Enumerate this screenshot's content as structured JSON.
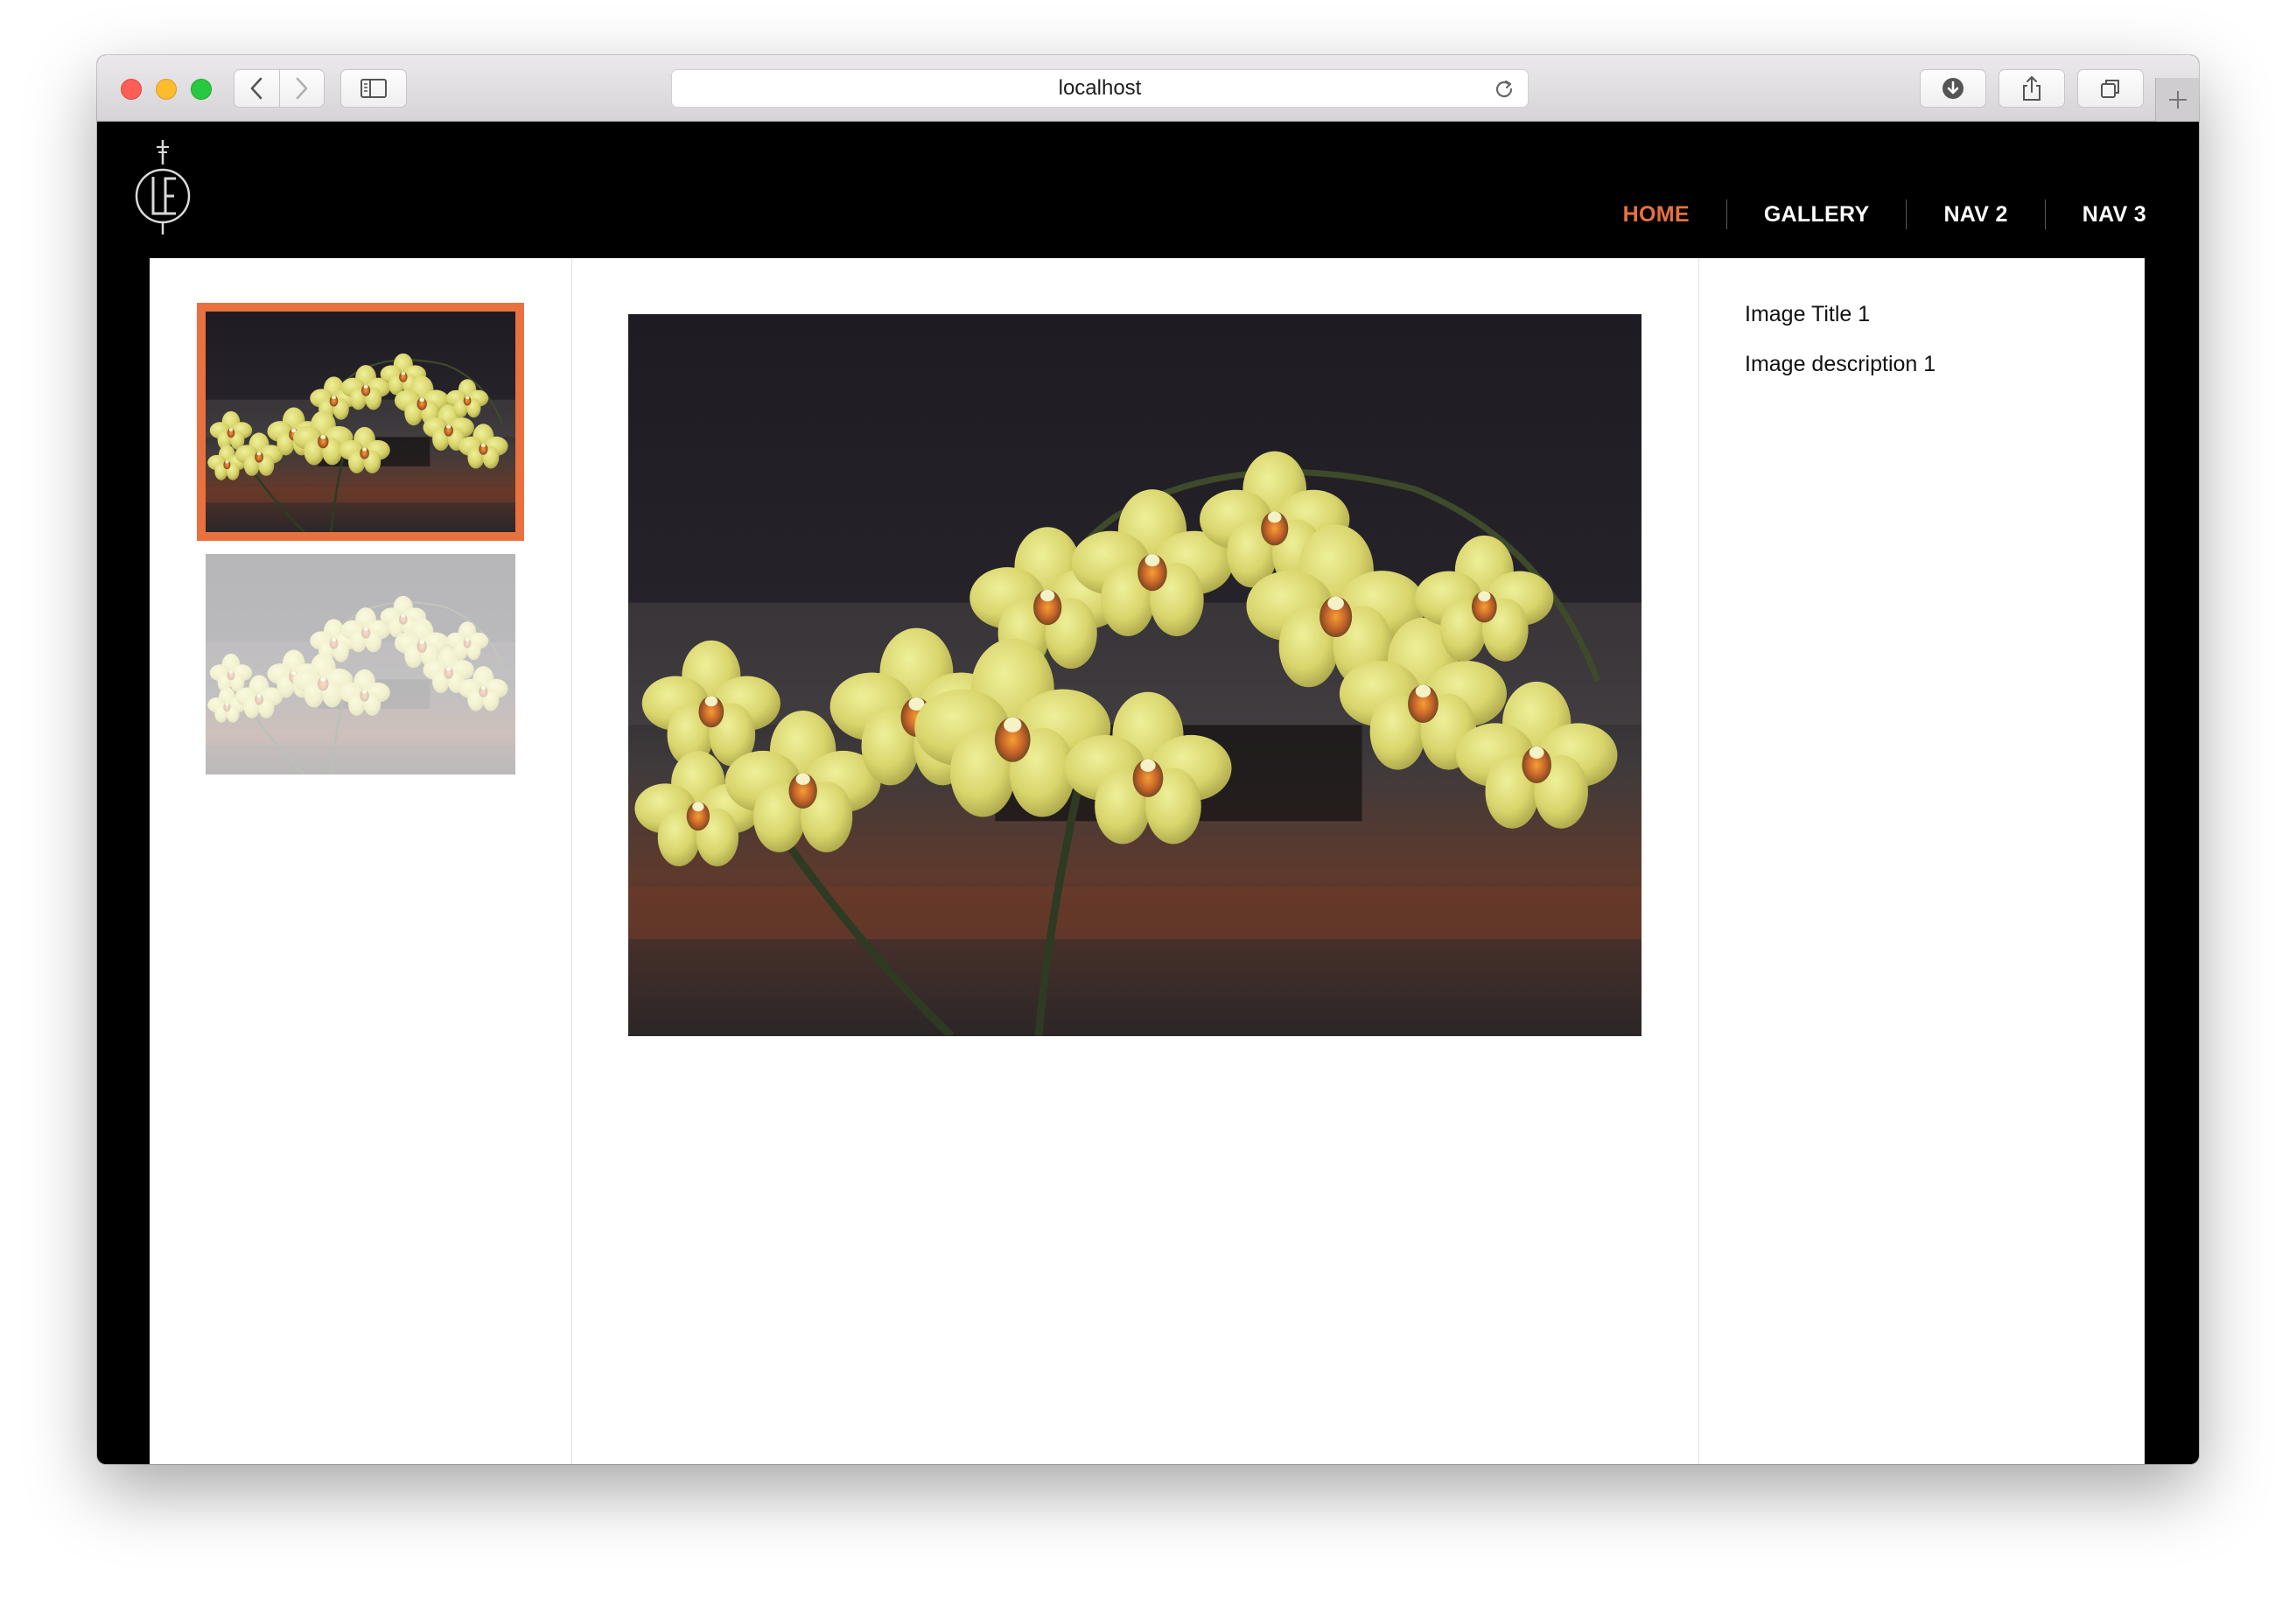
{
  "browser": {
    "url": "localhost",
    "icons": {
      "back": "chevron-left-icon",
      "forward": "chevron-right-icon",
      "sidebar": "sidebar-icon",
      "reload": "reload-icon",
      "downloads": "download-icon",
      "share": "share-icon",
      "tabs": "tabs-overview-icon",
      "new_tab": "plus-icon"
    }
  },
  "site": {
    "logo_name": "LE monogram logo",
    "nav": [
      {
        "label": "HOME",
        "active": true
      },
      {
        "label": "GALLERY",
        "active": false
      },
      {
        "label": "NAV 2",
        "active": false
      },
      {
        "label": "NAV 3",
        "active": false
      }
    ],
    "accent_color": "#e8713f"
  },
  "gallery": {
    "thumbnails": [
      {
        "selected": true
      },
      {
        "selected": false
      }
    ],
    "main_image": {
      "subject": "yellow orchids"
    },
    "info": {
      "title": "Image Title 1",
      "description": "Image description 1"
    }
  }
}
